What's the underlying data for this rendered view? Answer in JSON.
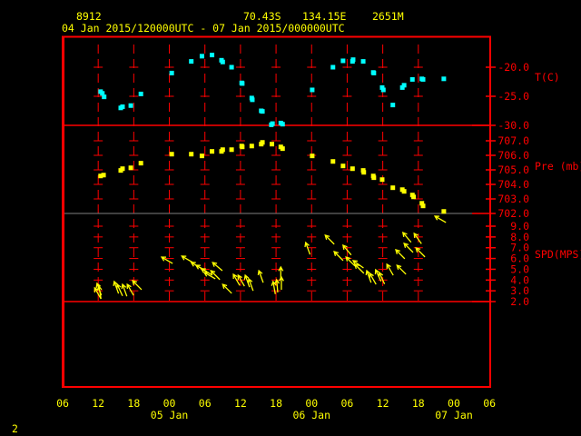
{
  "header": {
    "station_id": "8912",
    "latitude": "70.43S",
    "longitude": "134.15E",
    "elevation": "2651M",
    "period": "04 Jan 2015/120000UTC - 07 Jan 2015/000000UTC"
  },
  "page_number": "2",
  "colors": {
    "frame": "#ff0000",
    "temperature": "#00ffff",
    "pressure": "#ffff00",
    "wind": "#ffff00",
    "text": "#ffff00"
  },
  "chart_data": {
    "type": "scatter",
    "x_units": "hours since 04 Jan 2015 00UTC",
    "xlim": [
      6,
      78
    ],
    "x_ticks": [
      {
        "h": 6,
        "label": "06"
      },
      {
        "h": 12,
        "label": "12"
      },
      {
        "h": 18,
        "label": "18"
      },
      {
        "h": 24,
        "label": "00"
      },
      {
        "h": 30,
        "label": "06"
      },
      {
        "h": 36,
        "label": "12"
      },
      {
        "h": 42,
        "label": "18"
      },
      {
        "h": 48,
        "label": "00"
      },
      {
        "h": 54,
        "label": "06"
      },
      {
        "h": 60,
        "label": "12"
      },
      {
        "h": 66,
        "label": "18"
      },
      {
        "h": 72,
        "label": "00"
      },
      {
        "h": 78,
        "label": "06"
      }
    ],
    "date_labels": [
      {
        "h": 24,
        "label": "05 Jan"
      },
      {
        "h": 48,
        "label": "06 Jan"
      },
      {
        "h": 72,
        "label": "07 Jan"
      }
    ],
    "panels": [
      {
        "name": "temperature",
        "ylabel": "T(C)",
        "ylim": [
          -30,
          -15
        ],
        "ticks": [
          {
            "v": -20,
            "label": "-20.0"
          },
          {
            "v": -25,
            "label": "-25.0"
          },
          {
            "v": -30,
            "label": "-30.0"
          }
        ],
        "points": [
          [
            12.4,
            -24.2
          ],
          [
            12.7,
            -24.5
          ],
          [
            13.0,
            -25.1
          ],
          [
            15.8,
            -27.0
          ],
          [
            16.1,
            -26.8
          ],
          [
            17.5,
            -26.6
          ],
          [
            19.2,
            -24.6
          ],
          [
            24.4,
            -21.0
          ],
          [
            27.7,
            -19.0
          ],
          [
            29.5,
            -18.1
          ],
          [
            31.2,
            -17.9
          ],
          [
            32.8,
            -18.8
          ],
          [
            33.0,
            -19.1
          ],
          [
            34.5,
            -20.0
          ],
          [
            36.2,
            -22.7
          ],
          [
            36.3,
            -22.8
          ],
          [
            37.9,
            -25.3
          ],
          [
            38.0,
            -25.6
          ],
          [
            39.5,
            -27.5
          ],
          [
            39.7,
            -27.6
          ],
          [
            41.2,
            -29.9
          ],
          [
            41.4,
            -29.7
          ],
          [
            42.8,
            -29.6
          ],
          [
            43.1,
            -29.8
          ],
          [
            48.1,
            -23.9
          ],
          [
            51.6,
            -20.0
          ],
          [
            53.3,
            -18.9
          ],
          [
            54.9,
            -19.0
          ],
          [
            55.0,
            -18.7
          ],
          [
            56.7,
            -19.0
          ],
          [
            58.4,
            -20.9
          ],
          [
            58.5,
            -21.0
          ],
          [
            59.9,
            -23.5
          ],
          [
            60.1,
            -23.9
          ],
          [
            61.7,
            -26.5
          ],
          [
            63.3,
            -23.5
          ],
          [
            63.6,
            -23.1
          ],
          [
            65.0,
            -22.1
          ],
          [
            66.6,
            -22.0
          ],
          [
            66.8,
            -22.1
          ],
          [
            70.3,
            -22.0
          ]
        ]
      },
      {
        "name": "pressure",
        "ylabel": "Pre (mb)",
        "ylim": [
          702,
          708
        ],
        "ticks": [
          {
            "v": 707,
            "label": "707.0"
          },
          {
            "v": 706,
            "label": "706.0"
          },
          {
            "v": 705,
            "label": "705.0"
          },
          {
            "v": 704,
            "label": "704.0"
          },
          {
            "v": 703,
            "label": "703.0"
          },
          {
            "v": 702,
            "label": "702.0"
          }
        ],
        "points": [
          [
            12.4,
            704.58
          ],
          [
            12.9,
            704.64
          ],
          [
            15.8,
            704.96
          ],
          [
            16.1,
            705.08
          ],
          [
            17.5,
            705.14
          ],
          [
            19.2,
            705.46
          ],
          [
            24.4,
            706.08
          ],
          [
            27.7,
            706.08
          ],
          [
            29.5,
            705.96
          ],
          [
            31.2,
            706.27
          ],
          [
            32.8,
            706.27
          ],
          [
            33.0,
            706.39
          ],
          [
            34.5,
            706.39
          ],
          [
            36.2,
            706.64
          ],
          [
            36.3,
            706.58
          ],
          [
            37.9,
            706.64
          ],
          [
            39.5,
            706.77
          ],
          [
            39.7,
            706.89
          ],
          [
            41.3,
            706.77
          ],
          [
            42.8,
            706.58
          ],
          [
            43.1,
            706.46
          ],
          [
            48.1,
            705.96
          ],
          [
            51.6,
            705.58
          ],
          [
            53.3,
            705.27
          ],
          [
            54.9,
            705.08
          ],
          [
            56.7,
            704.96
          ],
          [
            56.8,
            704.83
          ],
          [
            58.4,
            704.58
          ],
          [
            58.5,
            704.46
          ],
          [
            59.9,
            704.33
          ],
          [
            61.7,
            703.77
          ],
          [
            63.3,
            703.64
          ],
          [
            63.6,
            703.52
          ],
          [
            65.0,
            703.27
          ],
          [
            65.2,
            703.14
          ],
          [
            66.6,
            702.7
          ],
          [
            66.8,
            702.52
          ],
          [
            70.3,
            702.14
          ]
        ]
      },
      {
        "name": "wind_speed",
        "ylabel": "SPD(MPS)",
        "ylim": [
          2,
          10
        ],
        "ticks": [
          {
            "v": 9,
            "label": "9.0"
          },
          {
            "v": 8,
            "label": "8.0"
          },
          {
            "v": 7,
            "label": "7.0"
          },
          {
            "v": 6,
            "label": "6.0"
          },
          {
            "v": 5,
            "label": "5.0"
          },
          {
            "v": 4,
            "label": "4.0"
          },
          {
            "v": 3,
            "label": "3.0"
          },
          {
            "v": 2,
            "label": "2.0"
          }
        ],
        "arrows_hour_speed_pointing_deg": [
          [
            11.4,
            3.27,
            330
          ],
          [
            11.8,
            3.69,
            340
          ],
          [
            12.1,
            3.43,
            350
          ],
          [
            14.7,
            3.86,
            340
          ],
          [
            15.2,
            3.6,
            335
          ],
          [
            16.1,
            3.6,
            340
          ],
          [
            16.9,
            3.6,
            330
          ],
          [
            17.8,
            3.94,
            315
          ],
          [
            22.7,
            6.13,
            300
          ],
          [
            26.1,
            6.22,
            300
          ],
          [
            27.7,
            5.63,
            300
          ],
          [
            28.5,
            5.37,
            300
          ],
          [
            29.4,
            5.04,
            300
          ],
          [
            29.9,
            4.7,
            300
          ],
          [
            31.3,
            5.63,
            310
          ],
          [
            31.0,
            4.87,
            315
          ],
          [
            33.0,
            3.6,
            315
          ],
          [
            34.8,
            4.53,
            330
          ],
          [
            35.6,
            4.45,
            330
          ],
          [
            36.8,
            4.45,
            340
          ],
          [
            37.4,
            4.11,
            340
          ],
          [
            39.1,
            4.87,
            340
          ],
          [
            41.5,
            3.86,
            350
          ],
          [
            42.1,
            4.03,
            355
          ],
          [
            42.8,
            5.21,
            0
          ],
          [
            42.9,
            4.28,
            0
          ],
          [
            47.0,
            7.48,
            340
          ],
          [
            50.3,
            8.16,
            315
          ],
          [
            51.8,
            6.64,
            315
          ],
          [
            53.3,
            7.23,
            320
          ],
          [
            53.8,
            6.13,
            315
          ],
          [
            55.0,
            5.8,
            305
          ],
          [
            55.3,
            5.46,
            315
          ],
          [
            57.3,
            4.87,
            340
          ],
          [
            57.8,
            4.62,
            330
          ],
          [
            58.8,
            4.95,
            335
          ],
          [
            59.4,
            4.7,
            335
          ],
          [
            60.7,
            5.46,
            330
          ],
          [
            62.4,
            5.37,
            315
          ],
          [
            62.2,
            6.81,
            315
          ],
          [
            63.4,
            8.41,
            320
          ],
          [
            63.6,
            7.4,
            315
          ],
          [
            65.3,
            8.33,
            325
          ],
          [
            65.6,
            6.98,
            315
          ],
          [
            68.8,
            9.93,
            300
          ]
        ]
      }
    ]
  }
}
